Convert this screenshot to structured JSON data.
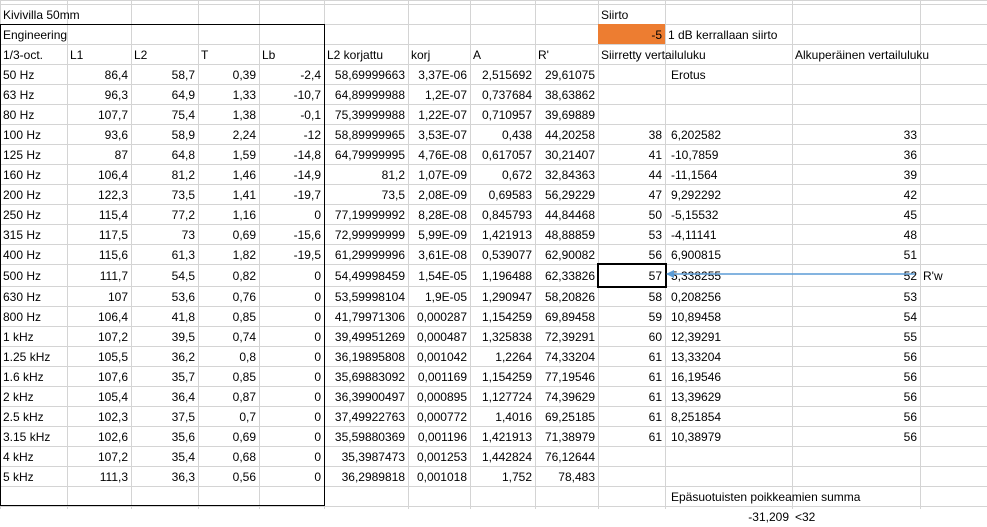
{
  "title": "Kivivilla 50mm",
  "engineering": "Engineering",
  "siirto": {
    "label": "Siirto",
    "value": "-5",
    "note": "1 dB kerrallaan siirto"
  },
  "columns": [
    "1/3-oct.",
    "L1",
    "L2",
    "T",
    "Lb",
    "L2 korjattu",
    "korj",
    "A",
    "R'"
  ],
  "siirretty_header": "Siirretty vertailuluku",
  "alkuperainen_header": "Alkuperäinen vertailuluku",
  "erotus_header": "Erotus",
  "rw_label": "R'w",
  "rows": [
    [
      "50 Hz",
      "86,4",
      "58,7",
      "0,39",
      "-2,4",
      "58,69999663",
      "3,37E-06",
      "2,515692",
      "29,61075",
      "",
      "",
      ""
    ],
    [
      "63 Hz",
      "96,3",
      "64,9",
      "1,33",
      "-10,7",
      "64,89999988",
      "1,2E-07",
      "0,737684",
      "38,63862",
      "",
      "",
      ""
    ],
    [
      "80 Hz",
      "107,7",
      "75,4",
      "1,38",
      "-0,1",
      "75,39999988",
      "1,22E-07",
      "0,710957",
      "39,69889",
      "",
      "",
      ""
    ],
    [
      "100 Hz",
      "93,6",
      "58,9",
      "2,24",
      "-12",
      "58,89999965",
      "3,53E-07",
      "0,438",
      "44,20258",
      "38",
      "6,202582",
      "33"
    ],
    [
      "125 Hz",
      "87",
      "64,8",
      "1,59",
      "-14,8",
      "64,79999995",
      "4,76E-08",
      "0,617057",
      "30,21407",
      "41",
      "-10,7859",
      "36"
    ],
    [
      "160 Hz",
      "106,4",
      "81,2",
      "1,46",
      "-14,9",
      "81,2",
      "1,07E-09",
      "0,672",
      "32,84363",
      "44",
      "-11,1564",
      "39"
    ],
    [
      "200 Hz",
      "122,3",
      "73,5",
      "1,41",
      "-19,7",
      "73,5",
      "2,08E-09",
      "0,69583",
      "56,29229",
      "47",
      "9,292292",
      "42"
    ],
    [
      "250 Hz",
      "115,4",
      "77,2",
      "1,16",
      "0",
      "77,19999992",
      "8,28E-08",
      "0,845793",
      "44,84468",
      "50",
      "-5,15532",
      "45"
    ],
    [
      "315 Hz",
      "117,5",
      "73",
      "0,69",
      "-15,6",
      "72,99999999",
      "5,99E-09",
      "1,421913",
      "48,88859",
      "53",
      "-4,11141",
      "48"
    ],
    [
      "400 Hz",
      "115,6",
      "61,3",
      "1,82",
      "-19,5",
      "61,29999996",
      "3,61E-08",
      "0,539077",
      "62,90082",
      "56",
      "6,900815",
      "51"
    ],
    [
      "500 Hz",
      "111,7",
      "54,5",
      "0,82",
      "0",
      "54,49998459",
      "1,54E-05",
      "1,196488",
      "62,33826",
      "57",
      "5,338255",
      "52"
    ],
    [
      "630 Hz",
      "107",
      "53,6",
      "0,76",
      "0",
      "53,59998104",
      "1,9E-05",
      "1,290947",
      "58,20826",
      "58",
      "0,208256",
      "53"
    ],
    [
      "800 Hz",
      "106,4",
      "41,8",
      "0,85",
      "0",
      "41,79971306",
      "0,000287",
      "1,154259",
      "69,89458",
      "59",
      "10,89458",
      "54"
    ],
    [
      "1 kHz",
      "107,2",
      "39,5",
      "0,74",
      "0",
      "39,49951269",
      "0,000487",
      "1,325838",
      "72,39291",
      "60",
      "12,39291",
      "55"
    ],
    [
      "1.25 kHz",
      "105,5",
      "36,2",
      "0,8",
      "0",
      "36,19895808",
      "0,001042",
      "1,2264",
      "74,33204",
      "61",
      "13,33204",
      "56"
    ],
    [
      "1.6 kHz",
      "107,6",
      "35,7",
      "0,85",
      "0",
      "35,69883092",
      "0,001169",
      "1,154259",
      "77,19546",
      "61",
      "16,19546",
      "56"
    ],
    [
      "2 kHz",
      "105,4",
      "36,4",
      "0,87",
      "0",
      "36,39900497",
      "0,000895",
      "1,127724",
      "74,39629",
      "61",
      "13,39629",
      "56"
    ],
    [
      "2.5 kHz",
      "102,3",
      "37,5",
      "0,7",
      "0",
      "37,49922763",
      "0,000772",
      "1,4016",
      "69,25185",
      "61",
      "8,251854",
      "56"
    ],
    [
      "3.15 kHz",
      "102,6",
      "35,6",
      "0,69",
      "0",
      "35,59880369",
      "0,001196",
      "1,421913",
      "71,38979",
      "61",
      "10,38979",
      "56"
    ],
    [
      "4 kHz",
      "107,2",
      "35,4",
      "0,68",
      "0",
      "35,3987473",
      "0,001253",
      "1,442824",
      "76,12644",
      "",
      "",
      ""
    ],
    [
      "5 kHz",
      "111,3",
      "36,3",
      "0,56",
      "0",
      "36,2989818",
      "0,001018",
      "1,752",
      "78,483",
      "",
      "",
      ""
    ]
  ],
  "footer": {
    "label": "Epäsuotuisten poikkeamien summa",
    "value": "-31,209",
    "limit": "<32"
  },
  "colors": {
    "orange": "#ed7d31",
    "arrow": "#5b9bd5",
    "grid": "#d4d4d4"
  }
}
